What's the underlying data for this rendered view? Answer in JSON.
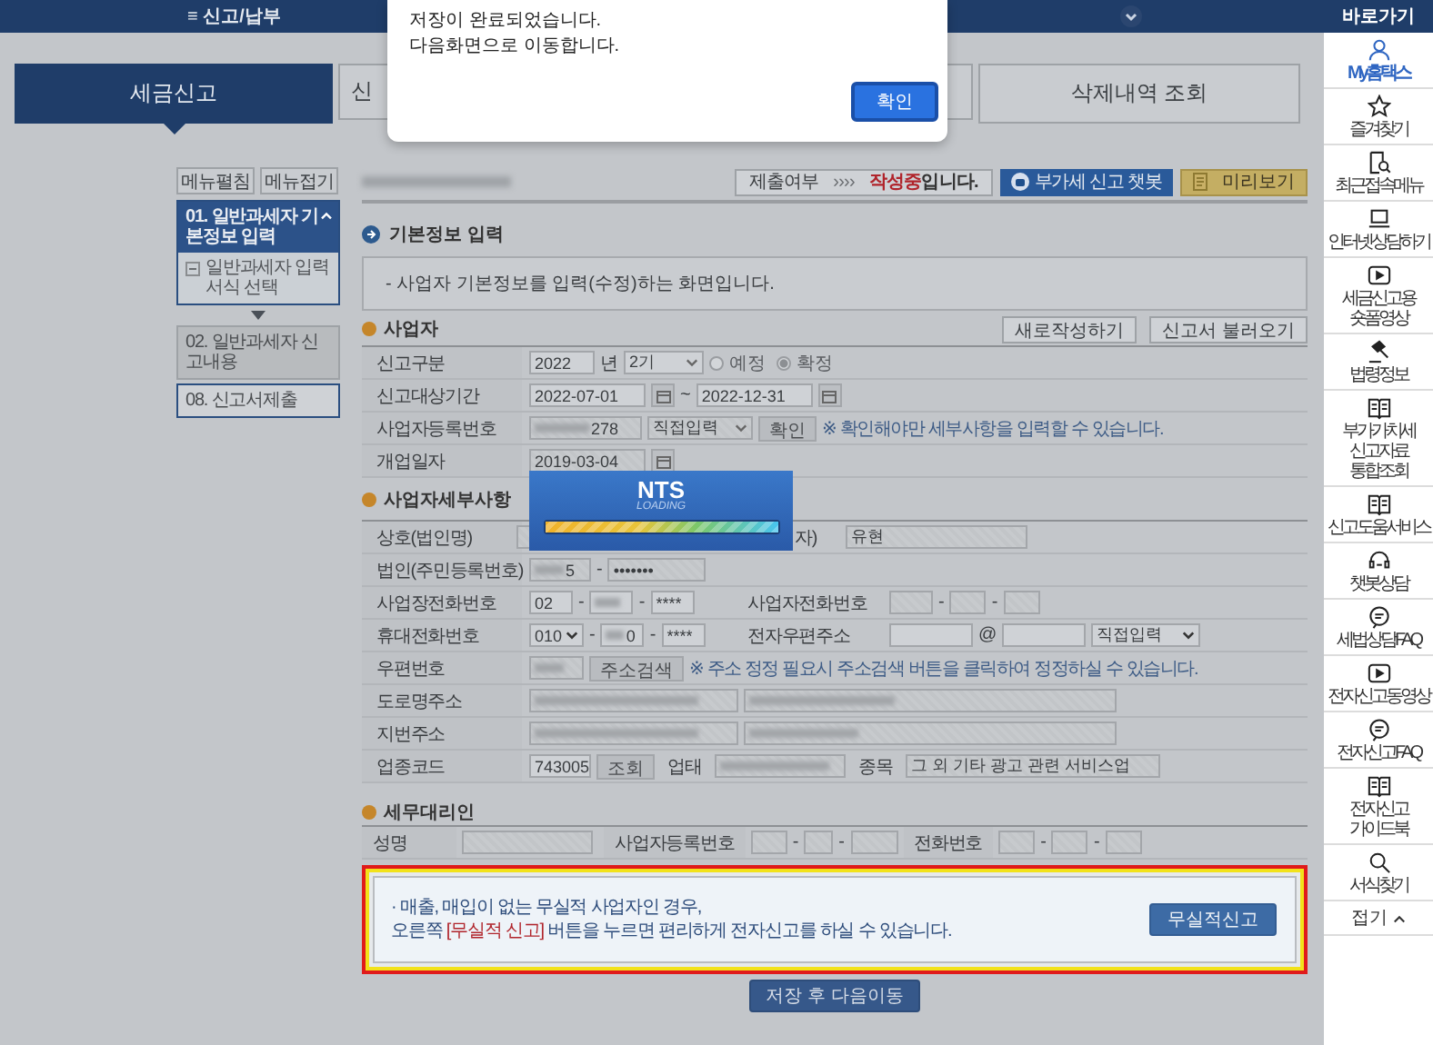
{
  "top_bar": {
    "menu_icon": "≡",
    "title": "신고/납부"
  },
  "tabs": [
    {
      "label": "세금신고",
      "selected": true
    },
    {
      "label": "신",
      "selected": false
    },
    {
      "label": "삭제내역 조회",
      "selected": false
    }
  ],
  "modal": {
    "lines": [
      "저장이 완료되었습니다.",
      "다음화면으로 이동합니다."
    ],
    "confirm_button": "확인"
  },
  "left_menu": {
    "buttons": [
      "메뉴펼침",
      "메뉴접기"
    ],
    "steps": [
      {
        "label": "01. 일반과세자 기본정보 입력",
        "selected": true,
        "expanded": true,
        "children": [
          {
            "label": "일반과세자 입력서식 선택"
          }
        ]
      },
      {
        "label": "02. 일반과세자 신고내용",
        "selected": false,
        "disabled": true
      },
      {
        "label": "08. 신고서제출",
        "selected": false,
        "disabled": false
      }
    ]
  },
  "header": {
    "status_label": "제출여부",
    "status_arrows": "››››",
    "status_state": "작성중",
    "status_suffix": "입니다.",
    "chatbot_button": "부가세 신고 챗봇",
    "preview_button": "미리보기"
  },
  "basic_info": {
    "title": "기본정보 입력",
    "note": "- 사업자 기본정보를 입력(수정)하는 화면입니다."
  },
  "business": {
    "title": "사업자",
    "buttons": [
      "새로작성하기",
      "신고서 불러오기"
    ],
    "report_type": {
      "label": "신고구분",
      "year": "2022",
      "year_unit": "년",
      "period": "2기",
      "options": [
        {
          "label": "예정",
          "selected": false
        },
        {
          "label": "확정",
          "selected": true
        }
      ]
    },
    "period": {
      "label": "신고대상기간",
      "start": "2022-07-01",
      "separator": "~",
      "end": "2022-12-31"
    },
    "business_number": {
      "label": "사업자등록번호",
      "value_tail": "278",
      "select": "직접입력",
      "confirm_button": "확인",
      "note": "※ 확인해야만 세부사항을 입력할 수 있습니다."
    },
    "open_date": {
      "label": "개업일자",
      "value": "2019-03-04"
    }
  },
  "details": {
    "title": "사업자세부사항",
    "trade_name": {
      "label": "상호(법인명)",
      "rep_label": "자)",
      "rep_value": "유현"
    },
    "resident_number": {
      "label": "법인(주민등록번호)",
      "first_tail": "5",
      "dash": "-",
      "second": "•••••••"
    },
    "business_phone": {
      "label": "사업장전화번호",
      "first": "02",
      "dash": "-",
      "third": "****",
      "right_label": "사업자전화번호"
    },
    "mobile": {
      "label": "휴대전화번호",
      "first": "010",
      "second_tail": "0",
      "dash": "-",
      "third": "****",
      "email_label": "전자우편주소",
      "at": "@",
      "domain_select": "직접입력"
    },
    "postal": {
      "label": "우편번호",
      "button": "주소검색",
      "note": "※ 주소 정정 필요시 주소검색 버튼을 클릭하여 정정하실 수 있습니다."
    },
    "road_address": {
      "label": "도로명주소"
    },
    "lot_address": {
      "label": "지번주소"
    },
    "industry": {
      "label": "업종코드",
      "code": "743005",
      "button": "조회",
      "type_label": "업태",
      "item_label": "종목",
      "item_value": "그 외 기타 광고 관련 서비스업"
    }
  },
  "agent": {
    "title": "세무대리인",
    "name_label": "성명",
    "number_label": "사업자등록번호",
    "phone_label": "전화번호",
    "dash": "-"
  },
  "notice": {
    "line1": "· 매출, 매입이 없는 무실적 사업자인 경우,",
    "line2_before": "오른쪽 ",
    "line2_highlight": "[무실적 신고]",
    "line2_after": " 버튼을 누르면 편리하게 전자신고를 하실 수 있습니다.",
    "button": "무실적신고"
  },
  "save_button": "저장 후 다음이동",
  "loading": {
    "title": "NTS",
    "subtitle": "LOADING",
    "level": 1
  },
  "sidebar": {
    "title": "바로가기",
    "items": [
      {
        "kind": "person",
        "label": "My홈택스",
        "selected": true
      },
      {
        "kind": "star",
        "label": "즐겨찾기",
        "selected": false
      },
      {
        "kind": "docsearch",
        "label": "최근접속메뉴",
        "selected": false
      },
      {
        "kind": "laptop",
        "label": "인터넷상담하기",
        "selected": false
      },
      {
        "kind": "play",
        "label": "세금신고용\n숏폼영상",
        "selected": false
      },
      {
        "kind": "gavel",
        "label": "법령정보",
        "selected": false
      },
      {
        "kind": "book",
        "label": "부가가치세\n신고자료\n통합조회",
        "selected": false
      },
      {
        "kind": "book",
        "label": "신고도움서비스",
        "selected": false
      },
      {
        "kind": "headset",
        "label": "챗봇상담",
        "selected": false
      },
      {
        "kind": "chat",
        "label": "세법상담FAQ",
        "selected": false
      },
      {
        "kind": "play",
        "label": "전자신고동영상",
        "selected": false
      },
      {
        "kind": "chat",
        "label": "전자신고FAQ",
        "selected": false
      },
      {
        "kind": "book",
        "label": "전자신고\n가이드북",
        "selected": false
      },
      {
        "kind": "search",
        "label": "서식찾기",
        "selected": false
      }
    ],
    "collapse": "접기"
  }
}
